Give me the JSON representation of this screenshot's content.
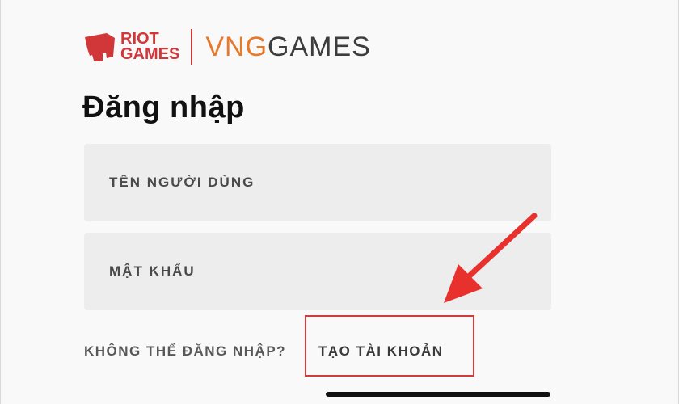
{
  "branding": {
    "riot_line1": "RIOT",
    "riot_line2": "GAMES",
    "vng_part": "VNG",
    "games_part": "GAMES"
  },
  "login": {
    "title": "Đăng nhập",
    "username_placeholder": "TÊN NGƯỜI DÙNG",
    "password_placeholder": "MẬT KHẨU",
    "cant_login_link": "KHÔNG THỂ ĐĂNG NHẬP?",
    "create_account_link": "TẠO TÀI KHOẢN"
  },
  "annotation": {
    "highlight_color": "#d13b3b",
    "arrow_color": "#e8302c"
  },
  "colors": {
    "riot_red": "#d13639",
    "vng_orange": "#e8792b",
    "field_bg": "#ededed"
  },
  "icons": {
    "riot_logo": "riot-fist-icon",
    "arrow": "red-arrow-icon"
  }
}
